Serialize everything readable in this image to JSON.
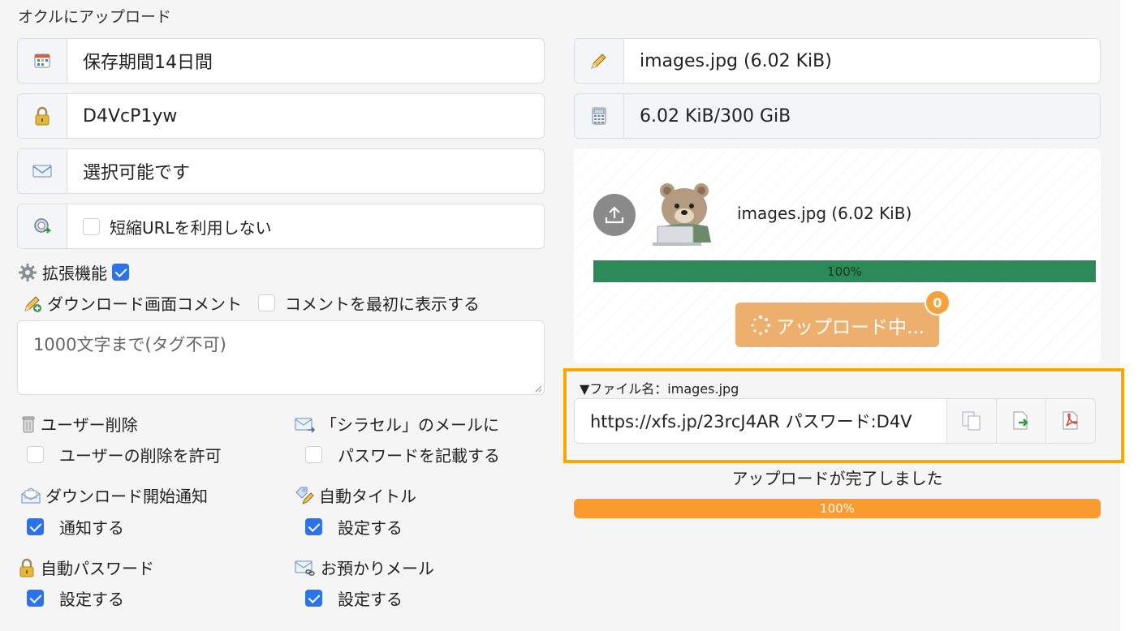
{
  "page": {
    "heading": "オクルにアップロード"
  },
  "left": {
    "retention": {
      "icon": "calendar-icon",
      "value": "保存期間14日間"
    },
    "password": {
      "icon": "lock-icon",
      "value": "D4VcP1yw"
    },
    "mail": {
      "icon": "mail-icon",
      "value": "選択可能です"
    },
    "short_url": {
      "icon": "link-refresh-icon",
      "checked": false,
      "label": "短縮URLを利用しない"
    },
    "extensions": {
      "icon": "gear-icon",
      "label": "拡張機能",
      "checked": true
    },
    "download_comment": {
      "icon": "pencil-add-icon",
      "label": "ダウンロード画面コメント",
      "first_checked": false,
      "first_label": "コメントを最初に表示する"
    },
    "comment_placeholder": "1000文字まで(タグ不可)",
    "options": [
      {
        "icon": "trash-icon",
        "title": "ユーザー削除",
        "checked": false,
        "label": "ユーザーの削除を許可"
      },
      {
        "icon": "mail-arrow-icon",
        "title": "「シラセル」のメールに",
        "checked": false,
        "label": "パスワードを記載する"
      },
      {
        "icon": "mail-open-icon",
        "title": "ダウンロード開始通知",
        "checked": true,
        "label": "通知する"
      },
      {
        "icon": "tag-edit-icon",
        "title": "自動タイトル",
        "checked": true,
        "label": "設定する"
      },
      {
        "icon": "lock-icon",
        "title": "自動パスワード",
        "checked": true,
        "label": "設定する"
      },
      {
        "icon": "mail-link-icon",
        "title": "お預かりメール",
        "checked": true,
        "label": "設定する"
      }
    ]
  },
  "right": {
    "file": {
      "icon": "pencil-icon",
      "value": "images.jpg (6.02 KiB)"
    },
    "quota": {
      "icon": "calculator-icon",
      "value": "6.02 KiB/300 GiB"
    },
    "upload": {
      "icon": "upload-icon",
      "thumbnail": "bear-at-laptop-image",
      "filename": "images.jpg (6.02 KiB)",
      "progress_label": "100%",
      "progress": 1.0,
      "button_label": "アップロード中...",
      "badge": "0"
    },
    "result": {
      "filename_label": "▼ファイル名：images.jpg",
      "url_text": "https://xfs.jp/23rcJ4AR パスワード:D4V",
      "buttons": [
        "copy-icon",
        "export-icon",
        "pdf-icon"
      ]
    },
    "done_text": "アップロードが完了しました",
    "final_progress_label": "100%",
    "final_progress": 1.0,
    "colors": {
      "highlight": "#ffa500",
      "progress_green": "#2c8a58",
      "progress_orange": "#fa9a2f",
      "checkbox": "#2b73ea"
    }
  }
}
